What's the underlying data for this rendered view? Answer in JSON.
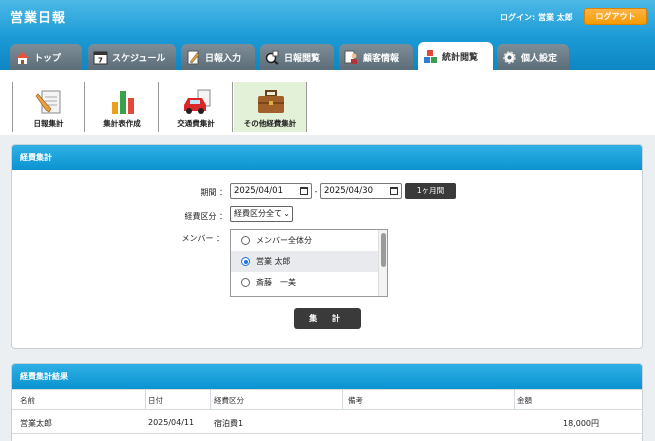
{
  "header": {
    "app_title": "営業日報",
    "login_label": "ログイン: 営業 太郎",
    "logout_label": "ログアウト"
  },
  "tabs": [
    {
      "label": "トップ",
      "icon": "house-icon"
    },
    {
      "label": "スケジュール",
      "icon": "calendar-icon"
    },
    {
      "label": "日報入力",
      "icon": "pen-document-icon"
    },
    {
      "label": "日報閲覧",
      "icon": "magnifier-icon"
    },
    {
      "label": "顧客情報",
      "icon": "customer-icon"
    },
    {
      "label": "統計閲覧",
      "icon": "blocks-icon"
    },
    {
      "label": "個人設定",
      "icon": "gear-icon"
    }
  ],
  "subnav": [
    {
      "label": "日報集計",
      "icon": "report-pencil-icon"
    },
    {
      "label": "集計表作成",
      "icon": "bar-chart-icon"
    },
    {
      "label": "交通費集計",
      "icon": "car-document-icon"
    },
    {
      "label": "その他経費集計",
      "icon": "briefcase-icon"
    }
  ],
  "search_panel": {
    "title": "経費集計",
    "period_label": "期間 ：",
    "date_from": "2025/04/01",
    "date_separator": "-",
    "date_to": "2025/04/30",
    "month_button": "1ヶ月間",
    "category_label": "経費区分 ：",
    "category_value": "経費区分全て",
    "member_label": "メンバー ：",
    "members": [
      {
        "label": "メンバー全体分",
        "checked": false
      },
      {
        "label": "営業 太郎",
        "checked": true
      },
      {
        "label": "斎藤　一美",
        "checked": false
      }
    ],
    "submit_label": "集 計"
  },
  "result_panel": {
    "title": "経費集計結果",
    "columns": [
      "名前",
      "日付",
      "経費区分",
      "備考",
      "金額"
    ],
    "rows": [
      {
        "name": "営業太郎",
        "date": "2025/04/11",
        "category": "宿泊費1",
        "note": "",
        "amount": "18,000円"
      }
    ]
  }
}
